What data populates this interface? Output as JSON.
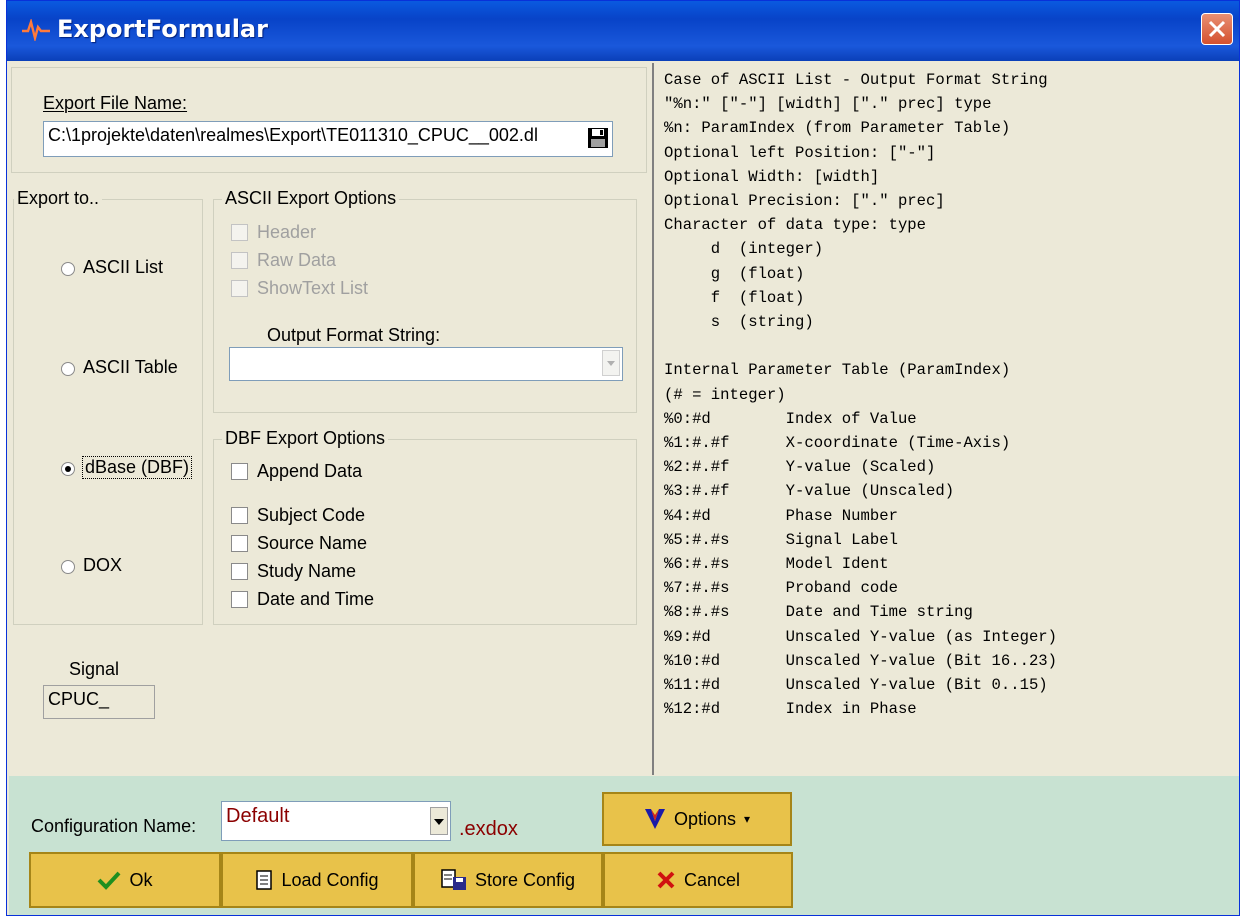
{
  "window": {
    "title": "ExportFormular"
  },
  "export_file": {
    "label": "Export File Name:",
    "value": "C:\\1projekte\\daten\\realmes\\Export\\TE011310_CPUC__002.dl"
  },
  "export_to": {
    "title": "Export to..",
    "options": [
      "ASCII List",
      "ASCII Table",
      "dBase (DBF)",
      "DOX"
    ],
    "selected": "dBase (DBF)"
  },
  "ascii_options": {
    "title": "ASCII Export Options",
    "header": "Header",
    "raw_data": "Raw Data",
    "show_text_list": "ShowText List",
    "format_label": "Output Format String:",
    "format_value": ""
  },
  "dbf_options": {
    "title": "DBF Export Options",
    "append_data": "Append Data",
    "subject_code": "Subject Code",
    "source_name": "Source Name",
    "study_name": "Study Name",
    "date_time": "Date and Time"
  },
  "signal": {
    "label": "Signal",
    "value": "CPUC_"
  },
  "help_text": [
    "Case of ASCII List - Output Format String",
    "\"%n:\" [\"-\"] [width] [\".\" prec] type",
    "%n: ParamIndex (from Parameter Table)",
    "Optional left Position: [\"-\"]",
    "Optional Width: [width]",
    "Optional Precision: [\".\" prec]",
    "Character of data type: type",
    "     d  (integer)",
    "     g  (float)",
    "     f  (float)",
    "     s  (string)",
    "",
    "Internal Parameter Table (ParamIndex)",
    "(# = integer)",
    "%0:#d        Index of Value",
    "%1:#.#f      X-coordinate (Time-Axis)",
    "%2:#.#f      Y-value (Scaled)",
    "%3:#.#f      Y-value (Unscaled)",
    "%4:#d        Phase Number",
    "%5:#.#s      Signal Label",
    "%6:#.#s      Model Ident",
    "%7:#.#s      Proband code",
    "%8:#.#s      Date and Time string",
    "%9:#d        Unscaled Y-value (as Integer)",
    "%10:#d       Unscaled Y-value (Bit 16..23)",
    "%11:#d       Unscaled Y-value (Bit 0..15)",
    "%12:#d       Index in Phase"
  ],
  "config": {
    "label": "Configuration Name:",
    "value": "Default",
    "extension": ".exdox"
  },
  "buttons": {
    "options": "Options",
    "ok": "Ok",
    "load": "Load Config",
    "store": "Store Config",
    "cancel": "Cancel"
  },
  "colors": {
    "title_bar": "#0843c8",
    "button": "#e8c24a",
    "footer": "#c8e2d2",
    "config_value": "#8b0000"
  }
}
